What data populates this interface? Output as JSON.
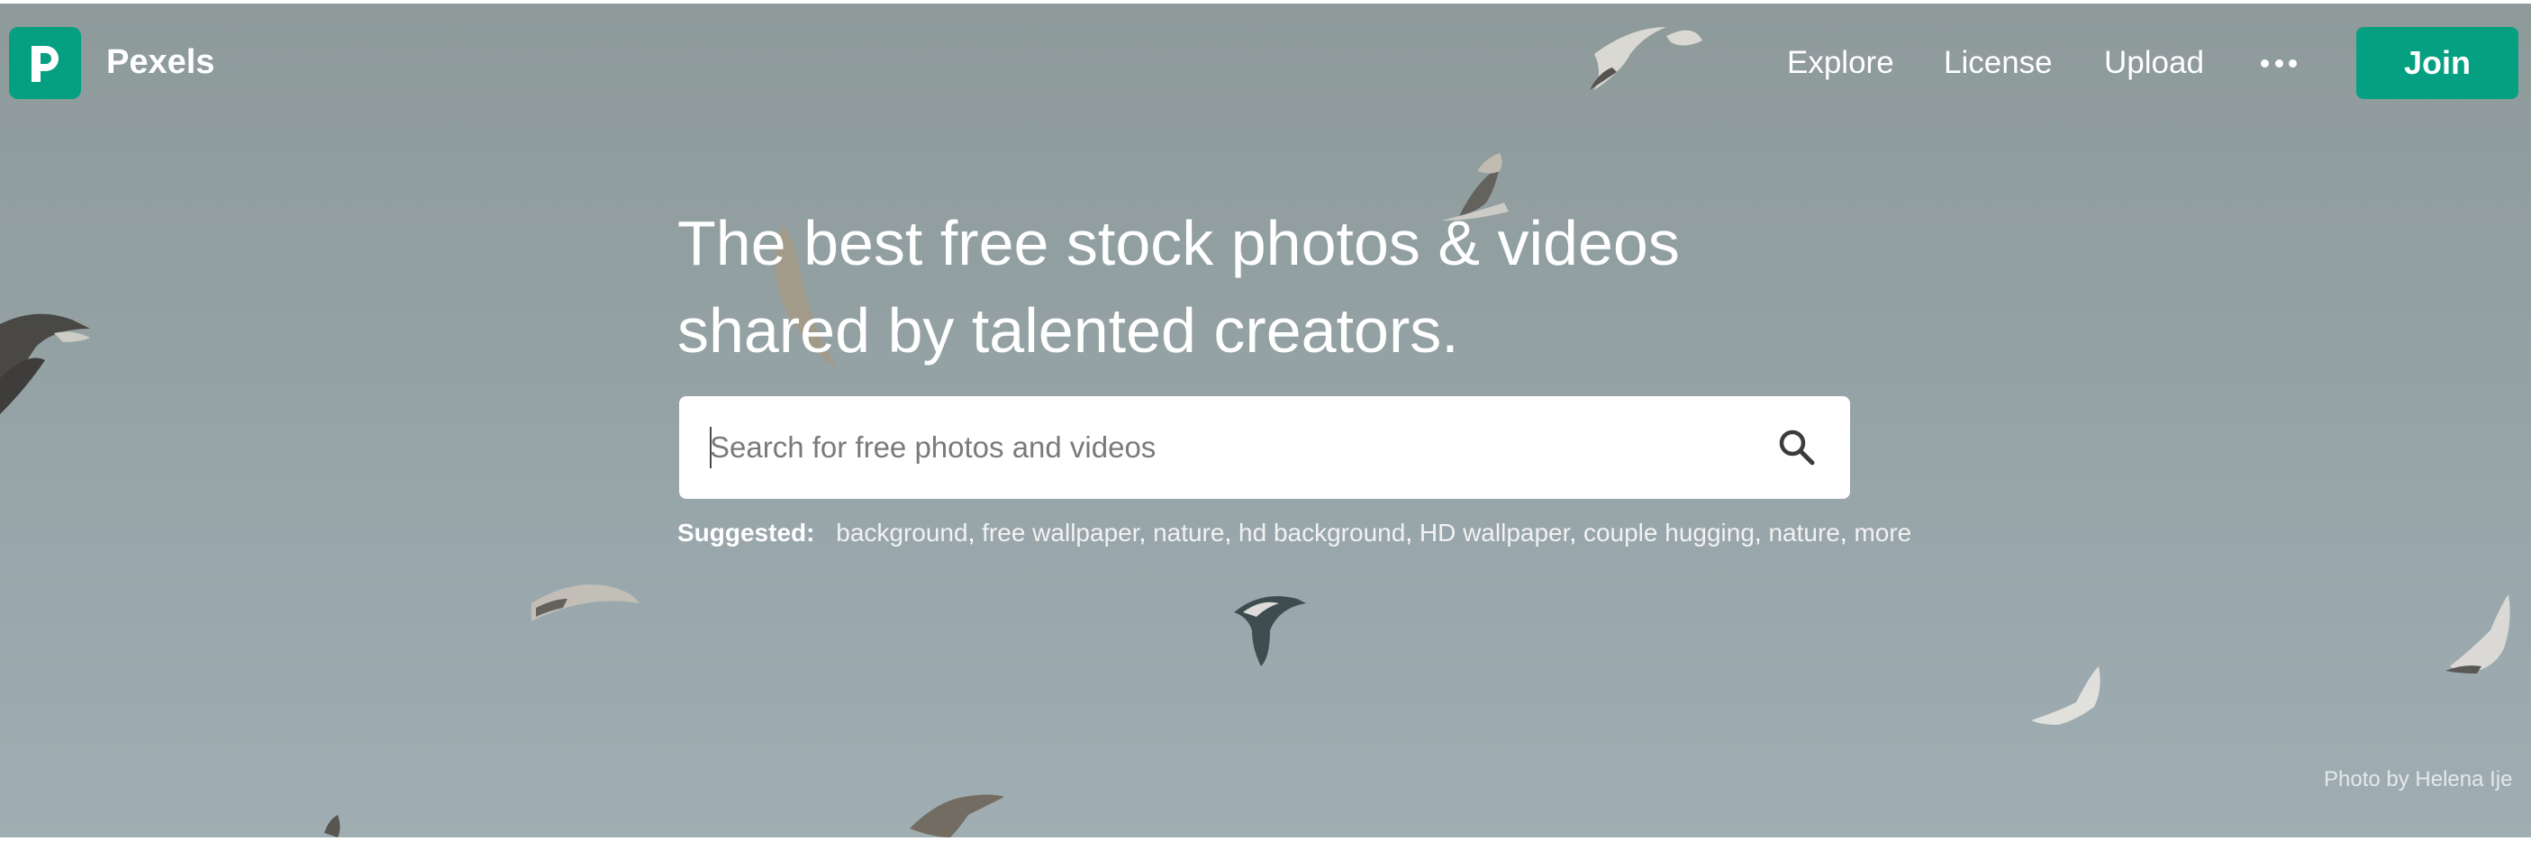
{
  "nav": {
    "brand": "Pexels",
    "links": [
      "Explore",
      "License",
      "Upload"
    ],
    "more_icon": "more-horizontal-icon",
    "join_label": "Join"
  },
  "hero": {
    "headline_line1": "The best free stock photos & videos",
    "headline_line2": "shared by talented creators."
  },
  "search": {
    "placeholder": "Search for free photos and videos",
    "value": "",
    "icon": "search-icon"
  },
  "suggested": {
    "label": "Suggested:",
    "items": [
      "background",
      "free wallpaper",
      "nature",
      "hd background",
      "HD wallpaper",
      "couple hugging",
      "nature",
      "more"
    ]
  },
  "credit": "Photo by Helena Ije",
  "colors": {
    "brand_green": "#05a081",
    "sky": "#93a0a2",
    "text_white": "#ffffff"
  }
}
